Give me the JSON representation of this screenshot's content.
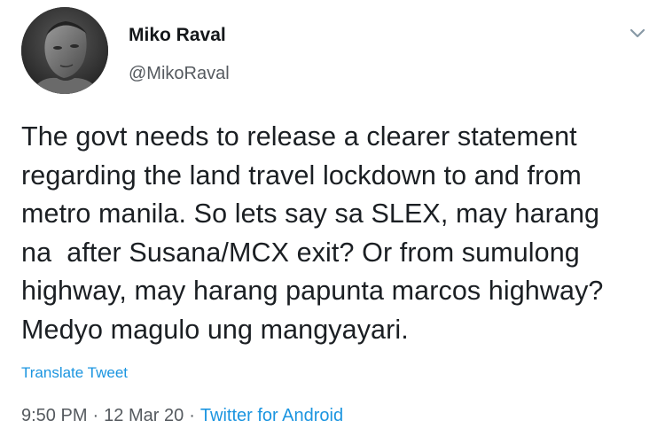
{
  "author": {
    "name": "Miko Raval",
    "handle": "@MikoRaval"
  },
  "tweet": {
    "lines": [
      "The govt needs to release a clearer statement",
      "regarding the land travel lockdown to and from",
      "metro manila. So lets say sa SLEX, may harang",
      "na  after Susana/MCX exit? Or from sumulong",
      "highway, may harang papunta marcos highway?",
      "Medyo magulo ung mangyayari."
    ],
    "translate_label": "Translate Tweet"
  },
  "meta": {
    "time": "9:50 PM",
    "date": "12 Mar 20",
    "separator": "·",
    "source": "Twitter for Android"
  },
  "icons": {
    "menu": "chevron-down-icon"
  },
  "colors": {
    "link": "#1b95e0",
    "secondary_text": "#555a5f",
    "primary_text": "#14171a"
  }
}
